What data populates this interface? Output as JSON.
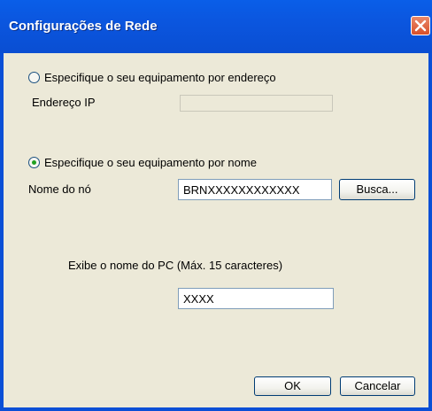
{
  "window": {
    "title": "Configurações de Rede"
  },
  "address_option": {
    "label": "Especifique o seu equipamento por endereço",
    "selected": false,
    "ip_label": "Endereço IP",
    "ip_value": ""
  },
  "name_option": {
    "label": "Especifique o seu equipamento por nome",
    "selected": true,
    "node_label": "Nome do nó",
    "node_value": "BRNXXXXXXXXXXXX",
    "search_button": "Busca..."
  },
  "pc_name": {
    "label": "Exibe o nome do PC (Máx. 15 caracteres)",
    "value": "XXXX"
  },
  "buttons": {
    "ok": "OK",
    "cancel": "Cancelar"
  },
  "icons": {
    "close": "close-icon"
  },
  "colors": {
    "titlebar": "#0a56df",
    "close": "#d9502a",
    "radio_dot": "#21a121"
  }
}
